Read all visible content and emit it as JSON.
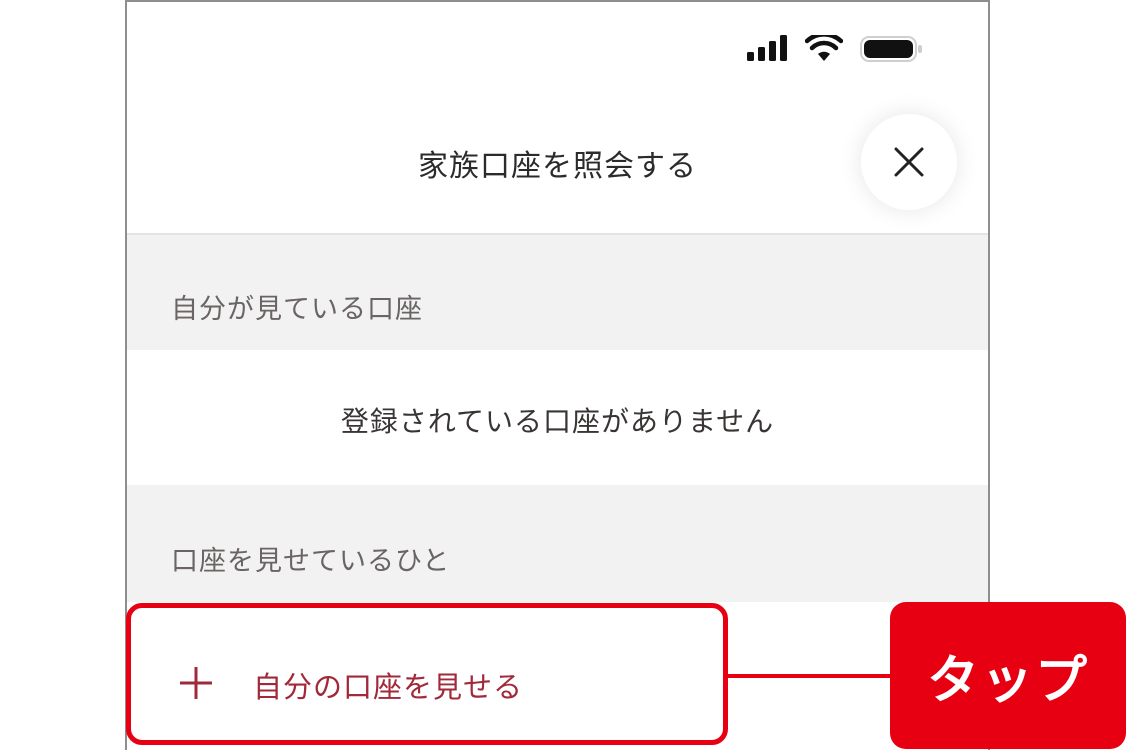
{
  "header": {
    "title": "家族口座を照会する",
    "close_icon": "close-icon"
  },
  "status_bar": {
    "icons": [
      "cellular-signal-icon",
      "wifi-icon",
      "battery-icon"
    ]
  },
  "sections": {
    "my_view": {
      "label": "自分が見ている口座",
      "empty_message": "登録されている口座がありません"
    },
    "showing_to": {
      "label": "口座を見せているひと"
    }
  },
  "action": {
    "add_label": "自分の口座を見せる",
    "icon": "plus-icon"
  },
  "callout": {
    "label": "タップ"
  },
  "colors": {
    "accent": "#e60012",
    "action_text": "#a1293a",
    "section_bg": "#f2f2f2"
  }
}
